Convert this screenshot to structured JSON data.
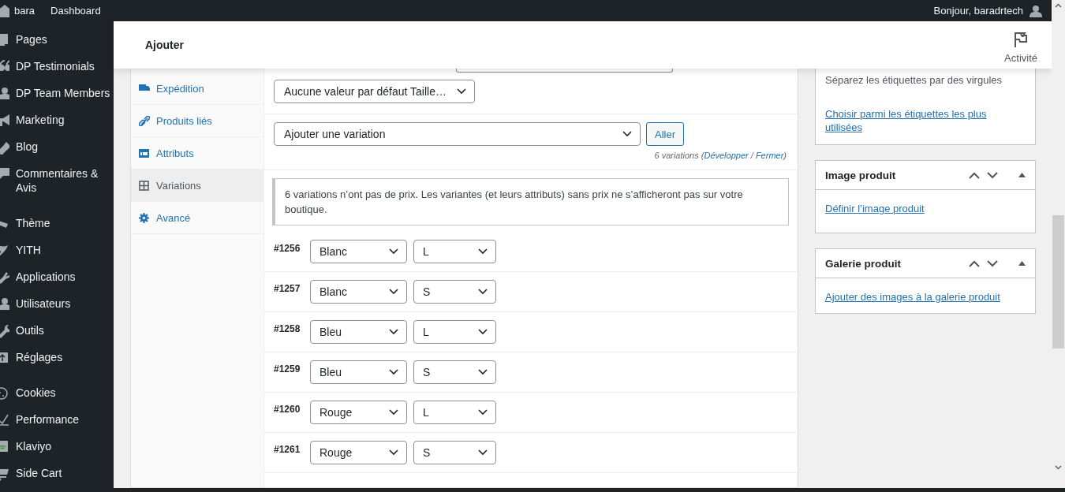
{
  "admin_bar": {
    "site": "bara",
    "dashboard": "Dashboard",
    "greeting": "Bonjour, baradrtech"
  },
  "menu_groups": [
    {
      "items": [
        {
          "label": "Pages"
        },
        {
          "label": "DP Testimonials"
        },
        {
          "label": "DP Team Members"
        },
        {
          "label": "Marketing"
        },
        {
          "label": "Blog"
        },
        {
          "label": "Commentaires & Avis"
        }
      ]
    },
    {
      "items": [
        {
          "label": "Thème"
        },
        {
          "label": "YITH"
        },
        {
          "label": "Applications"
        },
        {
          "label": "Utilisateurs"
        },
        {
          "label": "Outils"
        },
        {
          "label": "Réglages"
        }
      ]
    },
    {
      "items": [
        {
          "label": "Cookies"
        },
        {
          "label": "Performance"
        },
        {
          "label": "Klaviyo"
        },
        {
          "label": "Side Cart"
        }
      ]
    }
  ],
  "header": {
    "title": "Ajouter",
    "activity": "Activité"
  },
  "product_tabs": [
    {
      "label": "Expédition",
      "selected": false
    },
    {
      "label": "Produits liés",
      "selected": false
    },
    {
      "label": "Attributs",
      "selected": false
    },
    {
      "label": "Variations",
      "selected": true
    },
    {
      "label": "Avancé",
      "selected": false
    }
  ],
  "default_select": "Aucune valeur par défaut Taille…",
  "add_select": "Ajouter une variation",
  "go_button": "Aller",
  "count": {
    "prefix": "6 variations (",
    "expand": "Développer",
    "separator": " / ",
    "collapse": "Fermer",
    "suffix": ")"
  },
  "notice": "6 variations n’ont pas de prix. Les variantes (et leurs attributs) sans prix ne s’afficheront pas sur votre boutique.",
  "variations": [
    {
      "id": "#1256",
      "options": [
        "Blanc",
        "L"
      ]
    },
    {
      "id": "#1257",
      "options": [
        "Blanc",
        "S"
      ]
    },
    {
      "id": "#1258",
      "options": [
        "Bleu",
        "L"
      ]
    },
    {
      "id": "#1259",
      "options": [
        "Bleu",
        "S"
      ]
    },
    {
      "id": "#1260",
      "options": [
        "Rouge",
        "L"
      ]
    },
    {
      "id": "#1261",
      "options": [
        "Rouge",
        "S"
      ]
    }
  ],
  "tags_box": {
    "hint": "Séparez les étiquettes par des virgules",
    "link": "Choisir parmi les étiquettes les plus utilisées"
  },
  "side_boxes": [
    {
      "title": "Image produit",
      "link": "Définir l’image produit"
    },
    {
      "title": "Galerie produit",
      "link": "Ajouter des images à la galerie produit"
    }
  ]
}
